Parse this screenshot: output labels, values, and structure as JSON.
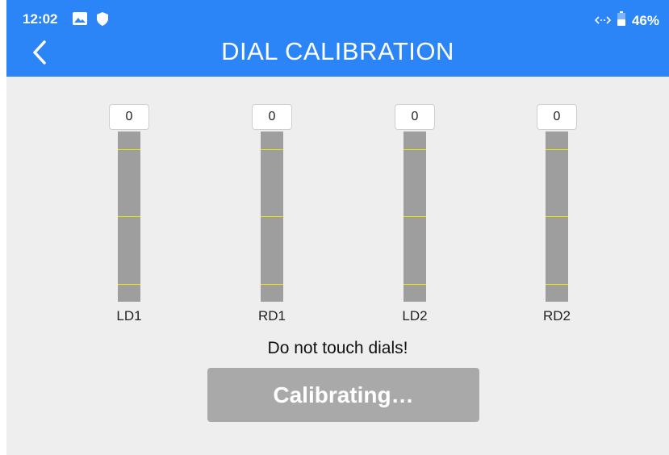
{
  "status_bar": {
    "time": "12:02",
    "battery": "46%",
    "icons": [
      "image-icon",
      "shield-icon",
      "data-transfer-icon",
      "battery-icon"
    ]
  },
  "header": {
    "back_icon": "chevron-left-icon",
    "title": "DIAL CALIBRATION"
  },
  "dials": [
    {
      "label": "LD1",
      "value": "0"
    },
    {
      "label": "RD1",
      "value": "0"
    },
    {
      "label": "LD2",
      "value": "0"
    },
    {
      "label": "RD2",
      "value": "0"
    }
  ],
  "message": "Do not touch dials!",
  "button": {
    "label": "Calibrating…"
  },
  "colors": {
    "header": "#2b85f7",
    "background": "#eeeeee",
    "bar": "#9e9e9e",
    "tick": "#f3e600",
    "button": "#a9a9a9"
  }
}
